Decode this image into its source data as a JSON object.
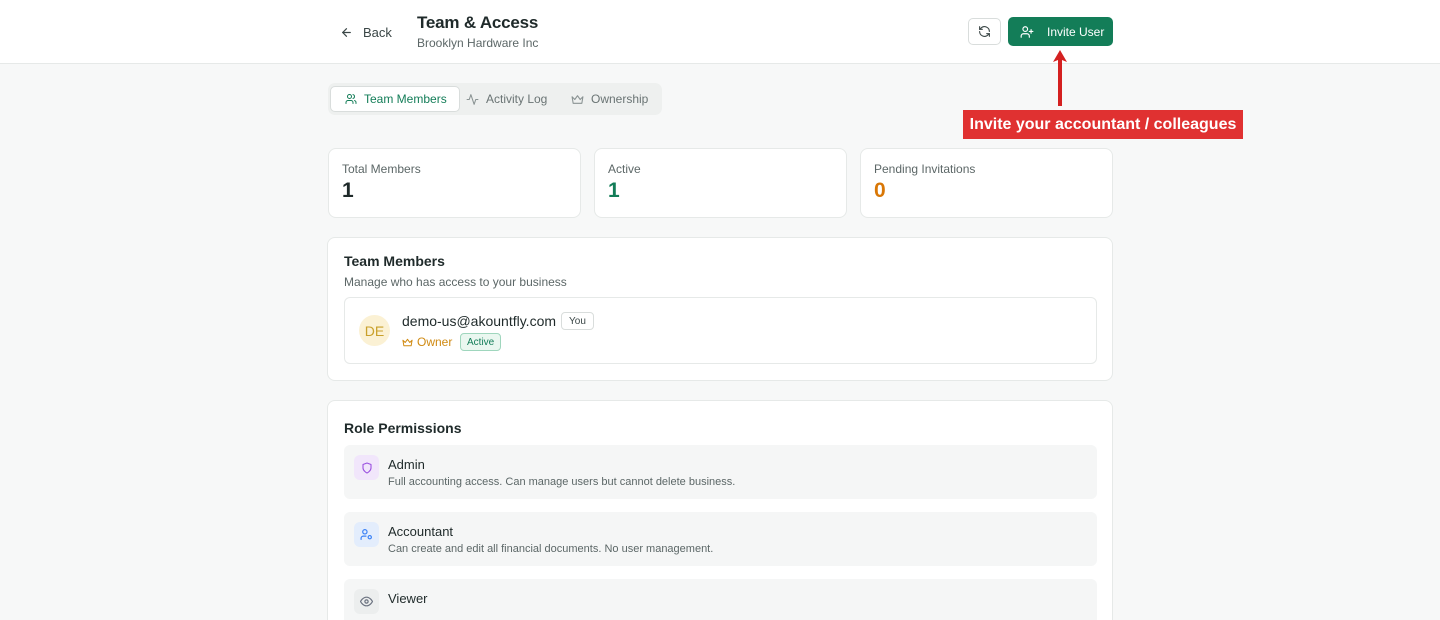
{
  "header": {
    "back_label": "Back",
    "title": "Team & Access",
    "subtitle": "Brooklyn Hardware Inc",
    "invite_label": "Invite User"
  },
  "annotation": {
    "callout_text": "Invite your accountant / colleagues",
    "color": "#e03131"
  },
  "tabs": [
    {
      "label": "Team Members",
      "icon": "users-icon",
      "active": true
    },
    {
      "label": "Activity Log",
      "icon": "activity-icon",
      "active": false
    },
    {
      "label": "Ownership",
      "icon": "crown-icon",
      "active": false
    }
  ],
  "stats": [
    {
      "label": "Total Members",
      "value": "1",
      "color": "#1f2a2a"
    },
    {
      "label": "Active",
      "value": "1",
      "color": "#137d58"
    },
    {
      "label": "Pending Invitations",
      "value": "0",
      "color": "#d97706"
    }
  ],
  "team_members": {
    "title": "Team Members",
    "description": "Manage who has access to your business",
    "members": [
      {
        "initials": "DE",
        "email": "demo-us@akountfly.com",
        "you_badge": "You",
        "role": "Owner",
        "status": "Active"
      }
    ]
  },
  "role_permissions": {
    "title": "Role Permissions",
    "roles": [
      {
        "name": "Admin",
        "description": "Full accounting access. Can manage users but cannot delete business.",
        "icon": "shield-icon",
        "icon_color": "#9b51e0"
      },
      {
        "name": "Accountant",
        "description": "Can create and edit all financial documents. No user management.",
        "icon": "user-cog-icon",
        "icon_color": "#3b82f6"
      },
      {
        "name": "Viewer",
        "description": "",
        "icon": "eye-icon",
        "icon_color": "#6b7280"
      }
    ]
  },
  "colors": {
    "primary": "#137d58",
    "background": "#f7f8f8"
  }
}
